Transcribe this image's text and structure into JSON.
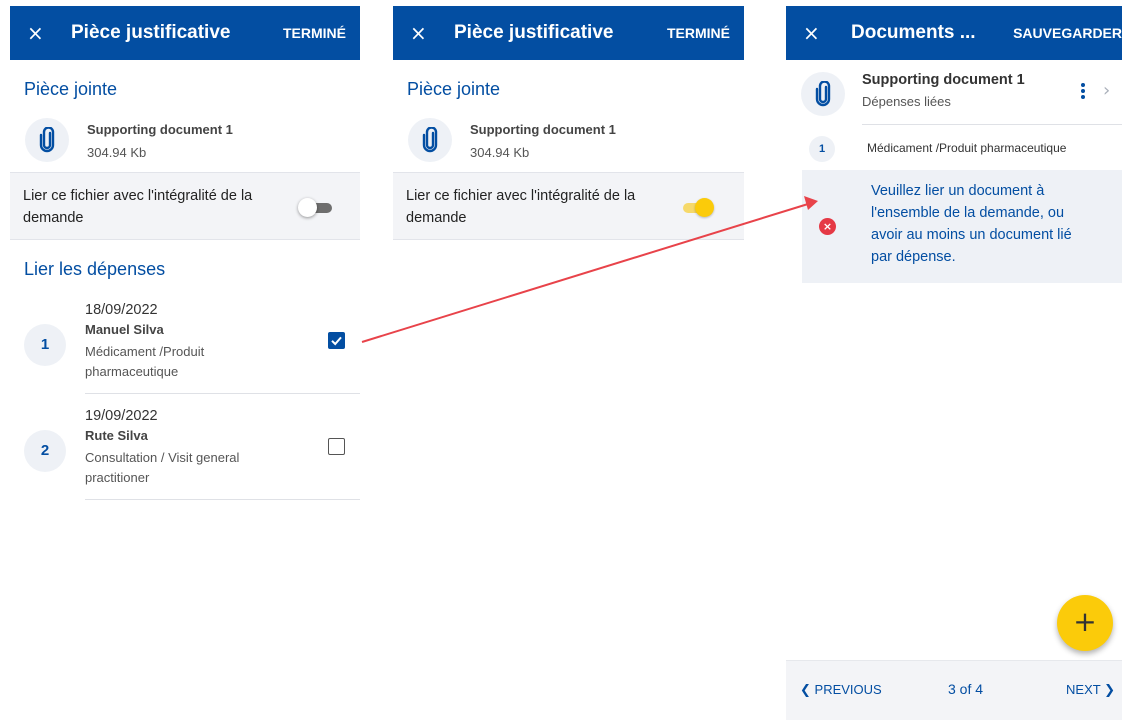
{
  "panel1": {
    "close_icon": "×",
    "title": "Pièce justificative",
    "action": "TERMINÉ",
    "attachment_section": "Pièce jointe",
    "file": {
      "icon": "paperclip-icon",
      "name": "Supporting document 1",
      "size": "304.94 Kb"
    },
    "link_label": "Lier ce fichier avec l'intégralité de la demande",
    "link_toggle": "off",
    "expenses_section": "Lier les dépenses",
    "expenses": [
      {
        "number": "1",
        "date": "18/09/2022",
        "name": "Manuel Silva",
        "type": "Médicament /Produit pharmaceutique",
        "checked": true
      },
      {
        "number": "2",
        "date": "19/09/2022",
        "name": "Rute Silva",
        "type": "Consultation / Visit general practitioner",
        "checked": false
      }
    ]
  },
  "panel2": {
    "close_icon": "×",
    "title": "Pièce justificative",
    "action": "TERMINÉ",
    "attachment_section": "Pièce jointe",
    "file": {
      "icon": "paperclip-icon",
      "name": "Supporting document 1",
      "size": "304.94 Kb"
    },
    "link_label": "Lier ce fichier avec l'intégralité de la demande",
    "link_toggle": "on"
  },
  "panel3": {
    "close_icon": "×",
    "title": "Documents ...",
    "action": "SAUVEGARDER",
    "document": {
      "icon": "paperclip-icon",
      "name": "Supporting document 1",
      "subtitle": "Dépenses liées",
      "more_icon": "kebab-menu-icon",
      "chevron": "›"
    },
    "linked_expense": {
      "number": "1",
      "label": "Médicament /Produit pharmaceutique"
    },
    "error": {
      "icon": "×",
      "message": "Veuillez lier un document à l'ensemble de la demande, ou avoir au moins un document lié par dépense."
    },
    "fab_icon": "+",
    "pager": {
      "prev_icon": "❮",
      "prev": "PREVIOUS",
      "count": "3 of 4",
      "next": "NEXT",
      "next_icon": "❯"
    }
  },
  "colors": {
    "brand_blue": "#034ea2",
    "accent_yellow": "#fbcb0a",
    "error_red": "#e53945",
    "annotation_arrow": "#e8434a",
    "row_background": "#f3f4f7"
  }
}
